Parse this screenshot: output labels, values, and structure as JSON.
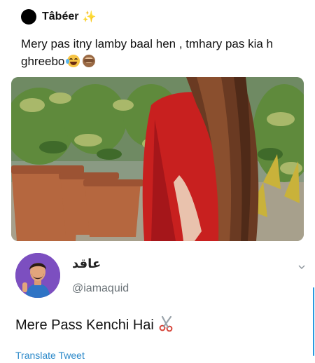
{
  "quoted_tweet": {
    "avatar_icon": "black-circle-avatar",
    "display_name": "Tâbéer",
    "name_decoration_icon": "sparkles-icon",
    "text": "Mery pas itny lamby baal hen , tmhary pas kia h ghreebo",
    "trailing_emojis": [
      "face-with-tears-of-joy-icon",
      "see-no-evil-monkey-icon"
    ],
    "media": {
      "kind": "photo",
      "description_icon": "tweet-photo"
    }
  },
  "reply_tweet": {
    "avatar_icon": "cartoon-avatar",
    "display_name": "عاقد",
    "handle": "@iamaquid",
    "text": "Mere Pass Kenchi Hai",
    "trailing_emoji": "scissors-icon",
    "menu_icon": "chevron-down-icon",
    "translate_label": "Translate Tweet"
  },
  "colors": {
    "link_blue": "#2a88c9",
    "handle_gray": "#6b7378",
    "sparkle_yellow": "#f2b707",
    "reply_avatar_purple": "#7c4fc0"
  }
}
